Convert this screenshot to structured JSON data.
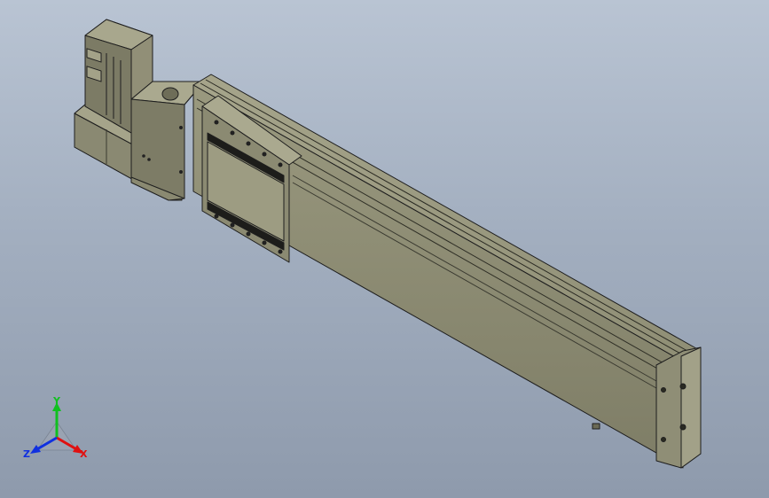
{
  "viewport": {
    "background_top": "#b9c4d3",
    "background_bottom": "#8e9aac"
  },
  "model": {
    "body_color": "#8c8b72",
    "body_dark": "#6b6a55",
    "body_light": "#a9a88e",
    "edge_color": "#1e1e1e"
  },
  "triad": {
    "x_label": "X",
    "y_label": "Y",
    "z_label": "Z",
    "x_color": "#e01010",
    "y_color": "#10c020",
    "z_color": "#1030e0"
  }
}
